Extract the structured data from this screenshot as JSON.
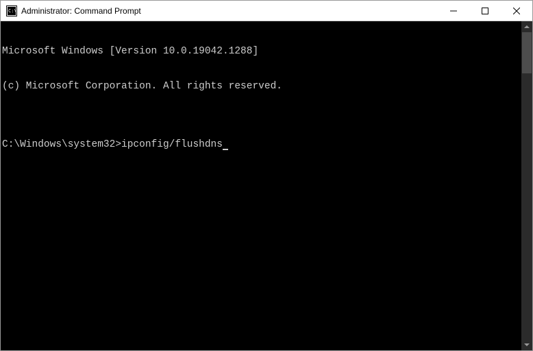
{
  "window": {
    "title": "Administrator: Command Prompt",
    "icon": "cmd"
  },
  "terminal": {
    "lines": [
      "Microsoft Windows [Version 10.0.19042.1288]",
      "(c) Microsoft Corporation. All rights reserved.",
      "",
      ""
    ],
    "prompt": "C:\\Windows\\system32>",
    "command": "ipconfig/flushdns"
  }
}
